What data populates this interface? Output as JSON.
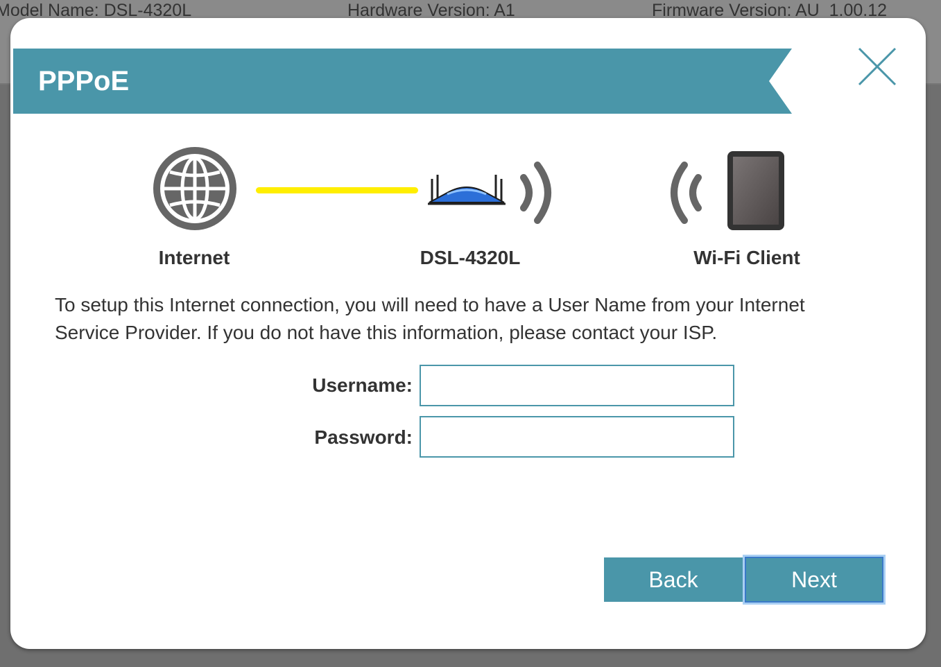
{
  "background": {
    "model_name": "Model Name: DSL-4320L",
    "hardware_version": "Hardware Version: A1",
    "firmware_version": "Firmware Version: AU_1.00.12"
  },
  "dialog": {
    "title": "PPPoE",
    "close_icon": "close-icon"
  },
  "diagram": {
    "internet_label": "Internet",
    "router_label": "DSL-4320L",
    "client_label": "Wi-Fi Client",
    "link_color": "#ffee00",
    "accent": "#4a96a9"
  },
  "description": "To setup this Internet connection, you will need to have a User Name from your Internet Service Provider. If you do not have this information, please contact your ISP.",
  "form": {
    "username_label": "Username:",
    "username_value": "",
    "password_label": "Password:",
    "password_value": ""
  },
  "buttons": {
    "back": "Back",
    "next": "Next"
  }
}
